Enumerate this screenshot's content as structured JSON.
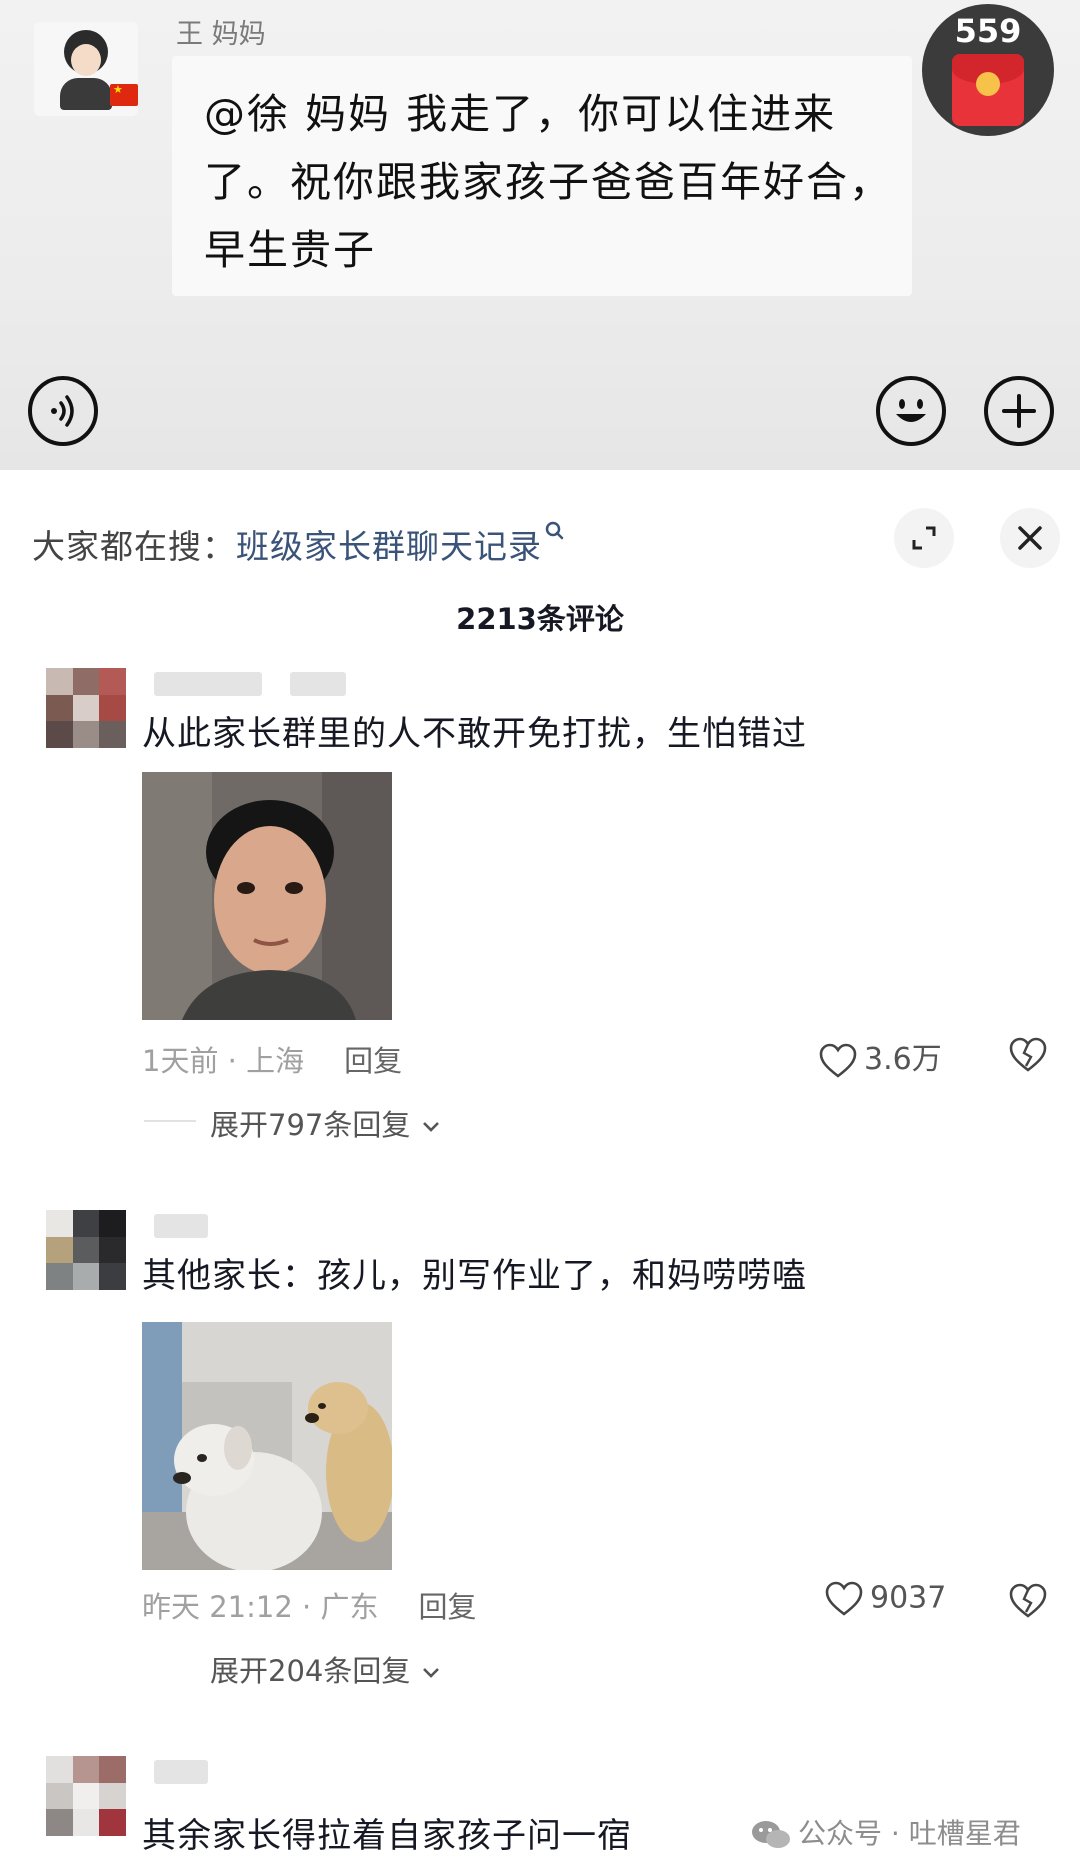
{
  "chat": {
    "sender": "王  妈妈",
    "message": "@徐  妈妈  我走了，你可以住进来了。祝你跟我家孩子爸爸百年好合，早生贵子",
    "red_packet_count": "559"
  },
  "sheet": {
    "search_prefix": "大家都在搜：",
    "search_term": "班级家长群聊天记录",
    "comment_count": "2213条评论"
  },
  "comments": [
    {
      "text": "从此家长群里的人不敢开免打扰，生怕错过",
      "time_location": "1天前 · 上海",
      "reply_label": "回复",
      "likes": "3.6万",
      "expand": "展开797条回复",
      "image_icon": "man-meme-photo"
    },
    {
      "text": "其他家长：孩儿，别写作业了，和妈唠唠嗑",
      "time_location": "昨天 21:12 · 广东",
      "reply_label": "回复",
      "likes": "9037",
      "expand": "展开204条回复",
      "image_icon": "two-dogs-photo"
    },
    {
      "text": "其余家长得拉着自家孩子问一宿"
    }
  ],
  "watermark": "公众号 · 吐槽星君",
  "icons": {
    "voice": "voice-icon",
    "emoji": "emoji-icon",
    "plus": "plus-icon",
    "expand": "expand-icon",
    "close": "close-icon",
    "like": "heart-icon",
    "dislike": "broken-heart-icon",
    "search": "search-icon",
    "chevron": "chevron-down-icon",
    "wechat": "wechat-icon"
  },
  "colors": {
    "search_term": "#3a5378",
    "red_packet": "#e8333a",
    "meta_gray": "#a0a0a0"
  }
}
